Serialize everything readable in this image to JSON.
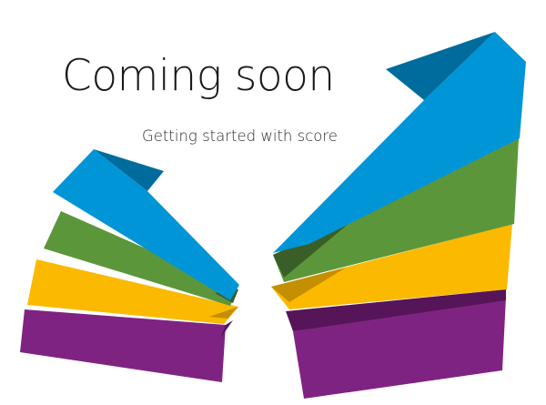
{
  "heading": {
    "title": "Coming soon",
    "subtitle": "Getting started with score"
  },
  "ribbons": {
    "colors": {
      "blue": "#0095d6",
      "blue_fold": "#006c9e",
      "green": "#5c963b",
      "green_fold": "#3a5e27",
      "yellow": "#fbb900",
      "yellow_fold": "#c48f00",
      "purple": "#7f2382",
      "purple_fold": "#561558"
    }
  }
}
